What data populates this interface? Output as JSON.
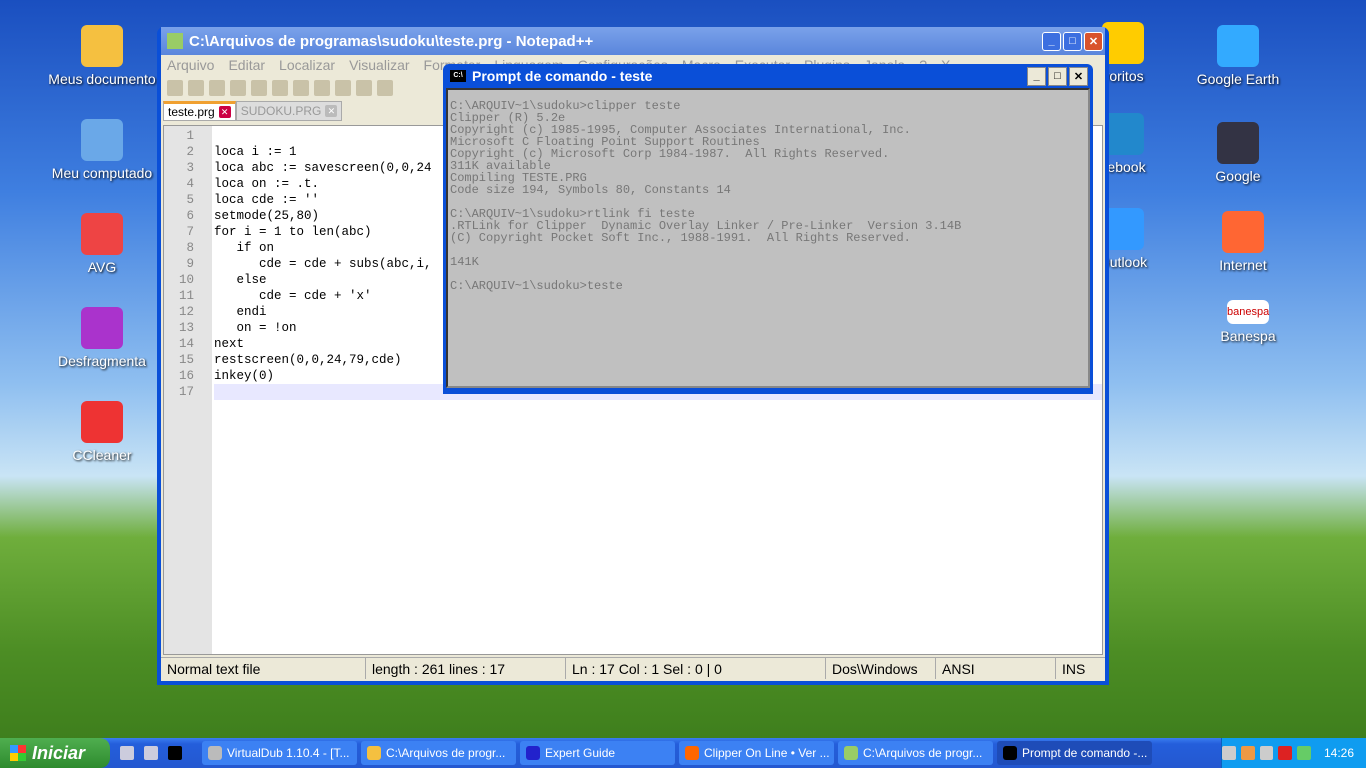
{
  "desktop": {
    "left": [
      "Meus documento",
      "Meu computado",
      "AVG",
      "Desfragmenta",
      "CCleaner"
    ],
    "right": [
      "voritos",
      "Google Earth",
      "cebook",
      "Google",
      "Outlook",
      "Internet",
      "Banespa"
    ],
    "banespa_logo": "banespa"
  },
  "notepad": {
    "title": "C:\\Arquivos de programas\\sudoku\\teste.prg - Notepad++",
    "menu": [
      "Arquivo",
      "Editar",
      "Localizar",
      "Visualizar",
      "Formatar",
      "Linguagem",
      "Configurações",
      "Macro",
      "Executar",
      "Plugins",
      "Janela",
      "?",
      "X"
    ],
    "tabs": [
      "teste.prg",
      "SUDOKU.PRG"
    ],
    "lines": [
      "",
      "loca i := 1",
      "loca abc := savescreen(0,0,24",
      "loca on := .t.",
      "loca cde := ''",
      "setmode(25,80)",
      "for i = 1 to len(abc)",
      "   if on",
      "      cde = cde + subs(abc,i,",
      "   else",
      "      cde = cde + 'x'",
      "   endi",
      "   on = !on",
      "next",
      "restscreen(0,0,24,79,cde)",
      "inkey(0)",
      ""
    ],
    "line_numbers": [
      "1",
      "2",
      "3",
      "4",
      "5",
      "6",
      "7",
      "8",
      "9",
      "10",
      "11",
      "12",
      "13",
      "14",
      "15",
      "16",
      "17"
    ],
    "status": {
      "type": "Normal text file",
      "length": "length : 261    lines : 17",
      "pos": "Ln : 17    Col : 1    Sel : 0 | 0",
      "eol": "Dos\\Windows",
      "enc": "ANSI",
      "mode": "INS"
    }
  },
  "cmd": {
    "title": "Prompt de comando - teste",
    "icon": "C:\\",
    "output": "C:\\ARQUIV~1\\sudoku>clipper teste\nClipper (R) 5.2e\nCopyright (c) 1985-1995, Computer Associates International, Inc.\nMicrosoft C Floating Point Support Routines\nCopyright (c) Microsoft Corp 1984-1987.  All Rights Reserved.\n311K available\nCompiling TESTE.PRG\nCode size 194, Symbols 80, Constants 14\n\nC:\\ARQUIV~1\\sudoku>rtlink fi teste\n.RTLink for Clipper  Dynamic Overlay Linker / Pre-Linker  Version 3.14B\n(C) Copyright Pocket Soft Inc., 1988-1991.  All Rights Reserved.\n\n141K\n\nC:\\ARQUIV~1\\sudoku>teste"
  },
  "taskbar": {
    "start": "Iniciar",
    "tasks": [
      "VirtualDub 1.10.4 - [T...",
      "C:\\Arquivos de progr...",
      "Expert Guide",
      "Clipper On Line • Ver ...",
      "C:\\Arquivos de progr...",
      "Prompt de comando -..."
    ],
    "clock": "14:26"
  }
}
